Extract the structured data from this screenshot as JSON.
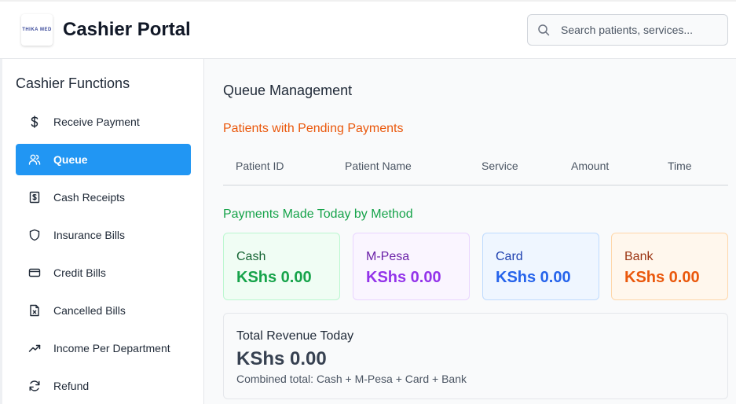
{
  "header": {
    "logo_text": "THIKA MED",
    "title": "Cashier Portal",
    "search_placeholder": "Search patients, services..."
  },
  "sidebar": {
    "title": "Cashier Functions",
    "items": [
      {
        "label": "Receive Payment",
        "icon": "dollar-icon",
        "active": false
      },
      {
        "label": "Queue",
        "icon": "users-icon",
        "active": true
      },
      {
        "label": "Cash Receipts",
        "icon": "receipt-icon",
        "active": false
      },
      {
        "label": "Insurance Bills",
        "icon": "shield-icon",
        "active": false
      },
      {
        "label": "Credit Bills",
        "icon": "credit-card-icon",
        "active": false
      },
      {
        "label": "Cancelled Bills",
        "icon": "file-x-icon",
        "active": false
      },
      {
        "label": "Income Per Department",
        "icon": "trending-up-icon",
        "active": false
      },
      {
        "label": "Refund",
        "icon": "refresh-icon",
        "active": false
      }
    ]
  },
  "main": {
    "title": "Queue Management",
    "pending_heading": "Patients with Pending Payments",
    "table_columns": [
      "Patient ID",
      "Patient Name",
      "Service",
      "Amount",
      "Time"
    ],
    "methods_heading": "Payments Made Today by Method",
    "methods": [
      {
        "label": "Cash",
        "value": "KShs 0.00",
        "bg": "#f0fdf4",
        "border": "#bbf7d0",
        "label_color": "#166534",
        "value_color": "#16a34a"
      },
      {
        "label": "M-Pesa",
        "value": "KShs 0.00",
        "bg": "#faf5ff",
        "border": "#e9d5ff",
        "label_color": "#6b21a8",
        "value_color": "#9333ea"
      },
      {
        "label": "Card",
        "value": "KShs 0.00",
        "bg": "#eff6ff",
        "border": "#bfdbfe",
        "label_color": "#1e40af",
        "value_color": "#2563eb"
      },
      {
        "label": "Bank",
        "value": "KShs 0.00",
        "bg": "#fff7ed",
        "border": "#fed7aa",
        "label_color": "#9a3412",
        "value_color": "#ea580c"
      }
    ],
    "total": {
      "label": "Total Revenue Today",
      "value": "KShs 0.00",
      "note": "Combined total: Cash + M-Pesa + Card + Bank"
    }
  }
}
